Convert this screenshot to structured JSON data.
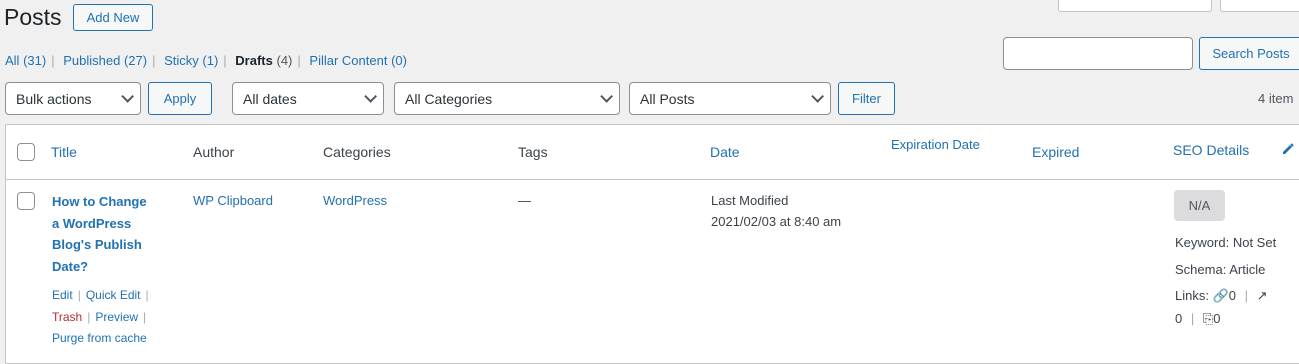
{
  "header": {
    "title": "Posts",
    "add_new": "Add New"
  },
  "views": [
    {
      "label": "All",
      "count": "(31)"
    },
    {
      "label": "Published",
      "count": "(27)"
    },
    {
      "label": "Sticky",
      "count": "(1)"
    },
    {
      "label": "Drafts",
      "count": "(4)",
      "current": true
    },
    {
      "label": "Pillar Content",
      "count": "(0)"
    }
  ],
  "search": {
    "value": "",
    "button": "Search Posts"
  },
  "filters": {
    "bulk_actions": "Bulk actions",
    "apply": "Apply",
    "dates": "All dates",
    "categories": "All Categories",
    "posts": "All Posts",
    "filter": "Filter",
    "items_count": "4 item"
  },
  "table": {
    "columns": {
      "title": "Title",
      "author": "Author",
      "categories": "Categories",
      "tags": "Tags",
      "date": "Date",
      "expiration_date": "Expiration Date",
      "expired": "Expired",
      "seo_details": "SEO Details"
    },
    "row": {
      "title_lines": [
        "How to Change",
        "a WordPress",
        "Blog's Publish",
        "Date?"
      ],
      "author": "WP Clipboard",
      "category": "WordPress",
      "tags": "—",
      "date_status": "Last Modified",
      "date_value": "2021/02/03 at 8:40 am",
      "actions": {
        "edit": "Edit",
        "quick_edit": "Quick Edit",
        "trash": "Trash",
        "preview": "Preview",
        "purge": "Purge from cache"
      },
      "seo": {
        "badge": "N/A",
        "keyword_label": "Keyword:",
        "keyword_value": "Not Set",
        "schema_label": "Schema:",
        "schema_value": "Article",
        "links_label": "Links:",
        "internal": "0",
        "external": "0",
        "incoming": "0"
      }
    }
  },
  "colors": {
    "link": "#2271b1",
    "trash": "#b32d2e",
    "bg": "#f0f0f1"
  }
}
